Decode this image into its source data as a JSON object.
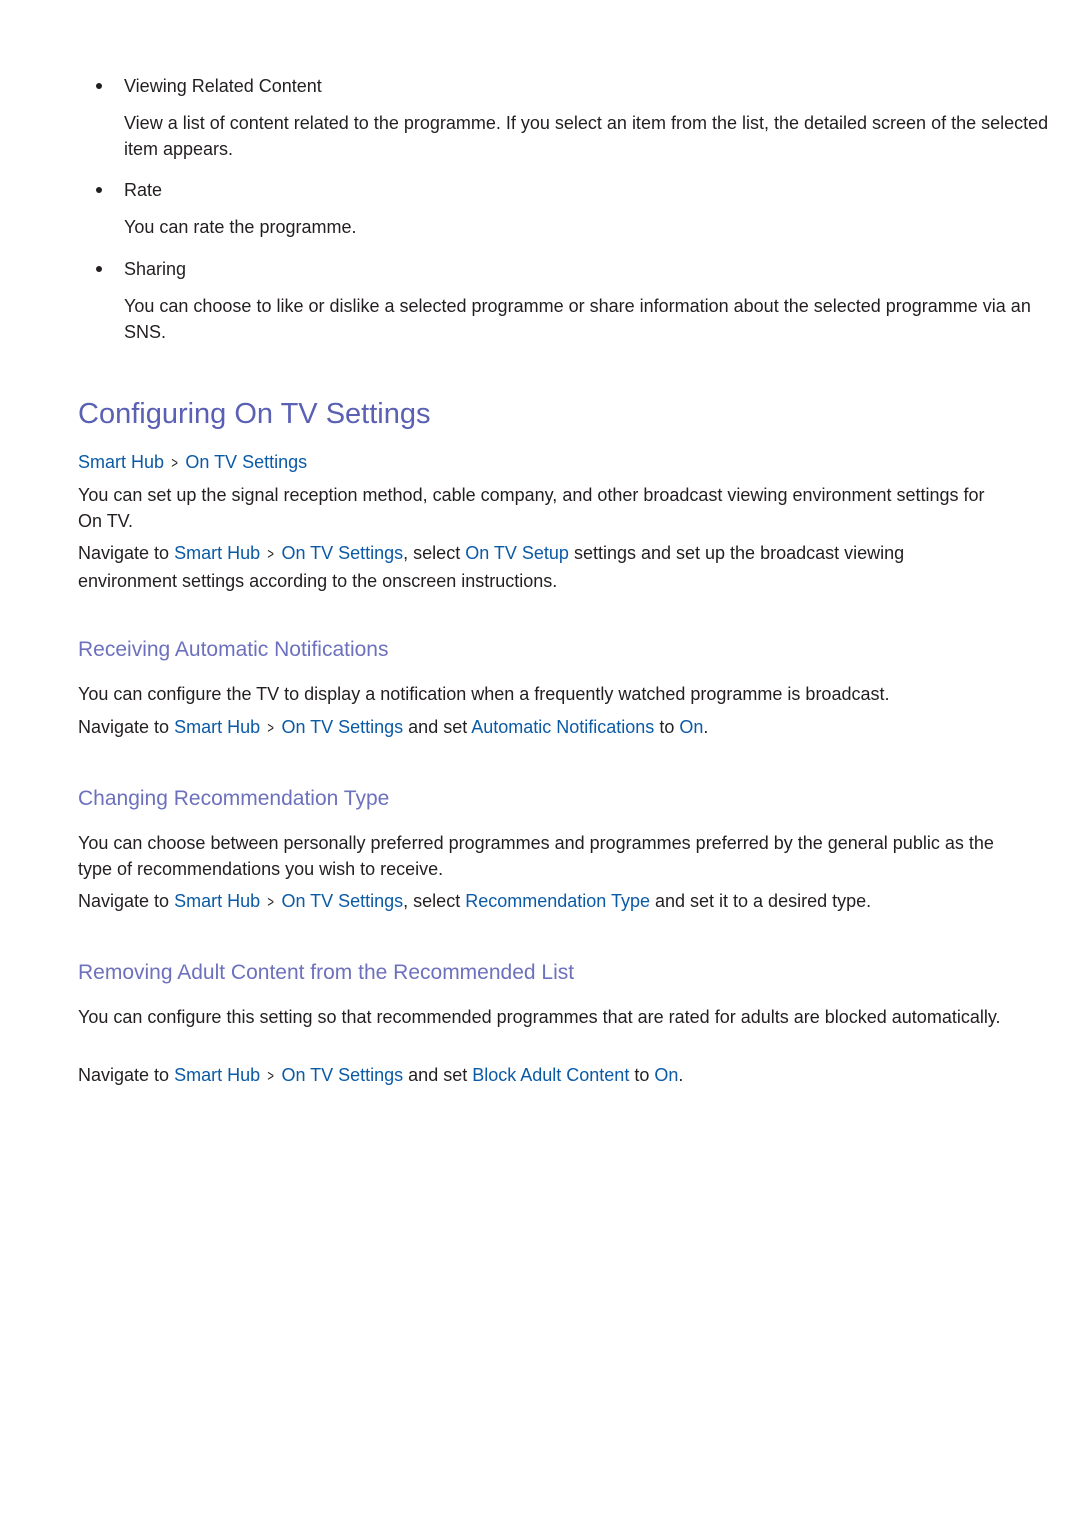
{
  "bullets": [
    {
      "title": "Viewing Related Content",
      "body": "View a list of content related to the programme. If you select an item from the list, the detailed screen of the selected item appears."
    },
    {
      "title": "Rate",
      "body": "You can rate the programme."
    },
    {
      "title": "Sharing",
      "body": "You can choose to like or dislike a selected programme or share information about the selected programme via an SNS."
    }
  ],
  "section": {
    "title": "Configuring On TV Settings",
    "breadcrumb": {
      "item1": "Smart Hub",
      "separator": ">",
      "item2": "On TV Settings"
    },
    "intro": "You can set up the signal reception method, cable company, and other broadcast viewing environment settings for On TV.",
    "navigate": {
      "prefix": "Navigate to ",
      "link1": "Smart Hub",
      "link2": "On TV Settings",
      "mid": ", select ",
      "link3": "On TV Setup",
      "suffix": " settings and set up the broadcast viewing environment settings according to the onscreen instructions."
    }
  },
  "subsections": [
    {
      "title": "Receiving Automatic Notifications",
      "body": "You can configure the TV to display a notification when a frequently watched programme is broadcast.",
      "navigate": {
        "prefix": "Navigate to ",
        "link1": "Smart Hub",
        "link2": "On TV Settings",
        "mid": " and set ",
        "link3": "Automatic Notifications",
        "to": " to ",
        "link4": "On",
        "end": "."
      }
    },
    {
      "title": "Changing Recommendation Type",
      "body": "You can choose between personally preferred programmes and programmes preferred by the general public as the type of recommendations you wish to receive.",
      "navigate": {
        "prefix": "Navigate to ",
        "link1": "Smart Hub",
        "link2": "On TV Settings",
        "mid": ", select ",
        "link3": "Recommendation Type",
        "suffix": " and set it to a desired type."
      }
    },
    {
      "title": "Removing Adult Content from the Recommended List",
      "body": "You can configure this setting so that recommended programmes that are rated for adults are blocked automatically.",
      "navigate": {
        "prefix": "Navigate to ",
        "link1": "Smart Hub",
        "link2": "On TV Settings",
        "mid": " and set ",
        "link3": "Block Adult Content",
        "to": " to ",
        "link4": "On",
        "end": "."
      }
    }
  ],
  "colors": {
    "heading": "#5a60b3",
    "subheading": "#6d71bd",
    "link": "#0b5aa6",
    "text": "#231f20"
  }
}
